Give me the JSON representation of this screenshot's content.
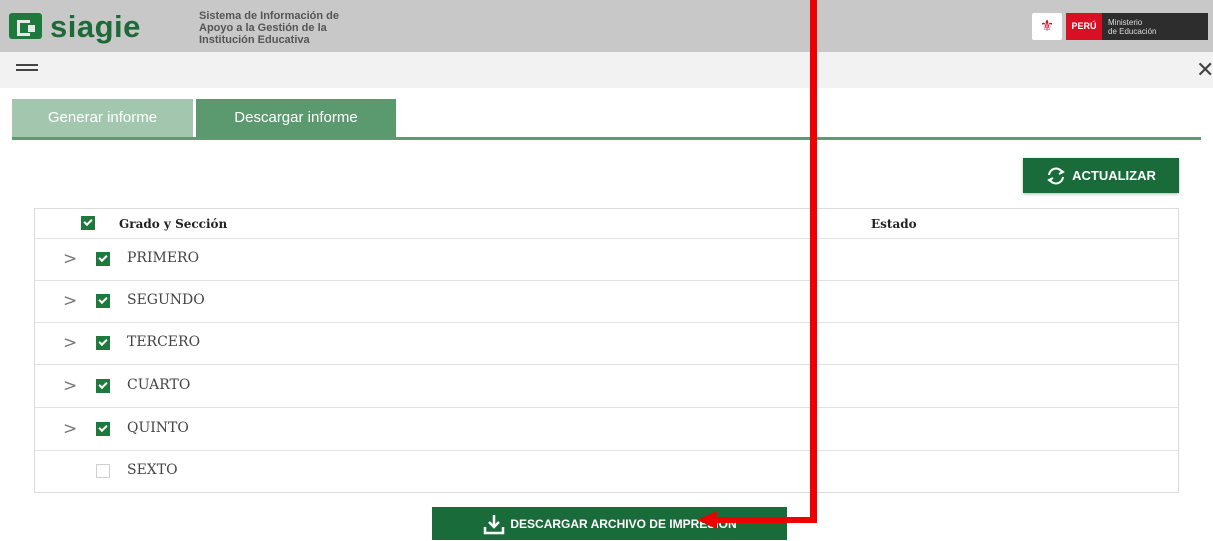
{
  "header": {
    "brand": "siagie",
    "subtitle_lines": [
      "Sistema de Información de",
      "Apoyo a la Gestión de la",
      "Institución Educativa"
    ],
    "gov_country": "PERÚ",
    "gov_ministry_lines": [
      "Ministerio",
      "de Educación"
    ]
  },
  "tabs": [
    {
      "label": "Generar informe",
      "active": false
    },
    {
      "label": "Descargar informe",
      "active": true
    }
  ],
  "refresh_label": "ACTUALIZAR",
  "table": {
    "col_grado": "Grado y Sección",
    "col_estado": "Estado",
    "header_checked": true,
    "rows": [
      {
        "label": "PRIMERO",
        "checked": true,
        "expandable": true
      },
      {
        "label": "SEGUNDO",
        "checked": true,
        "expandable": true
      },
      {
        "label": "TERCERO",
        "checked": true,
        "expandable": true
      },
      {
        "label": "CUARTO",
        "checked": true,
        "expandable": true
      },
      {
        "label": "QUINTO",
        "checked": true,
        "expandable": true
      },
      {
        "label": "SEXTO",
        "checked": false,
        "expandable": false
      }
    ]
  },
  "download_label": "DESCARGAR ARCHIVO DE IMPRESIÓN",
  "colors": {
    "primary_green": "#1a6b3a",
    "tab_active": "#5b9a6f",
    "tab_inactive": "#a3c7ae",
    "annotation_red": "#ee0000"
  }
}
